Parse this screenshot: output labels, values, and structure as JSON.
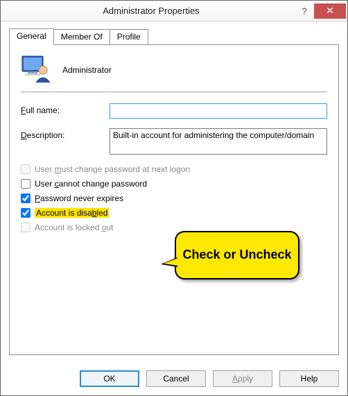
{
  "window": {
    "title": "Administrator Properties"
  },
  "tabs": {
    "general": "General",
    "memberof": "Member Of",
    "profile": "Profile"
  },
  "header": {
    "account_name": "Administrator"
  },
  "form": {
    "fullname_label_pre": "",
    "fullname_ul": "F",
    "fullname_label_post": "ull name:",
    "fullname_value": "",
    "description_ul": "D",
    "description_label_post": "escription:",
    "description_value": "Built-in account for administering the computer/domain"
  },
  "checks": {
    "c1_pre": "User ",
    "c1_ul": "m",
    "c1_post": "ust change password at next logon",
    "c2_pre": "User ",
    "c2_ul": "c",
    "c2_post": "annot change password",
    "c3_pre": "",
    "c3_ul": "P",
    "c3_post": "assword never expires",
    "c4_pre": "Account is disa",
    "c4_ul": "b",
    "c4_post": "led",
    "c5_pre": "Account is locked ",
    "c5_ul": "o",
    "c5_post": "ut"
  },
  "callout": {
    "text": "Check or Uncheck"
  },
  "buttons": {
    "ok": "OK",
    "cancel": "Cancel",
    "apply_ul": "A",
    "apply_post": "pply",
    "help": "Help"
  }
}
